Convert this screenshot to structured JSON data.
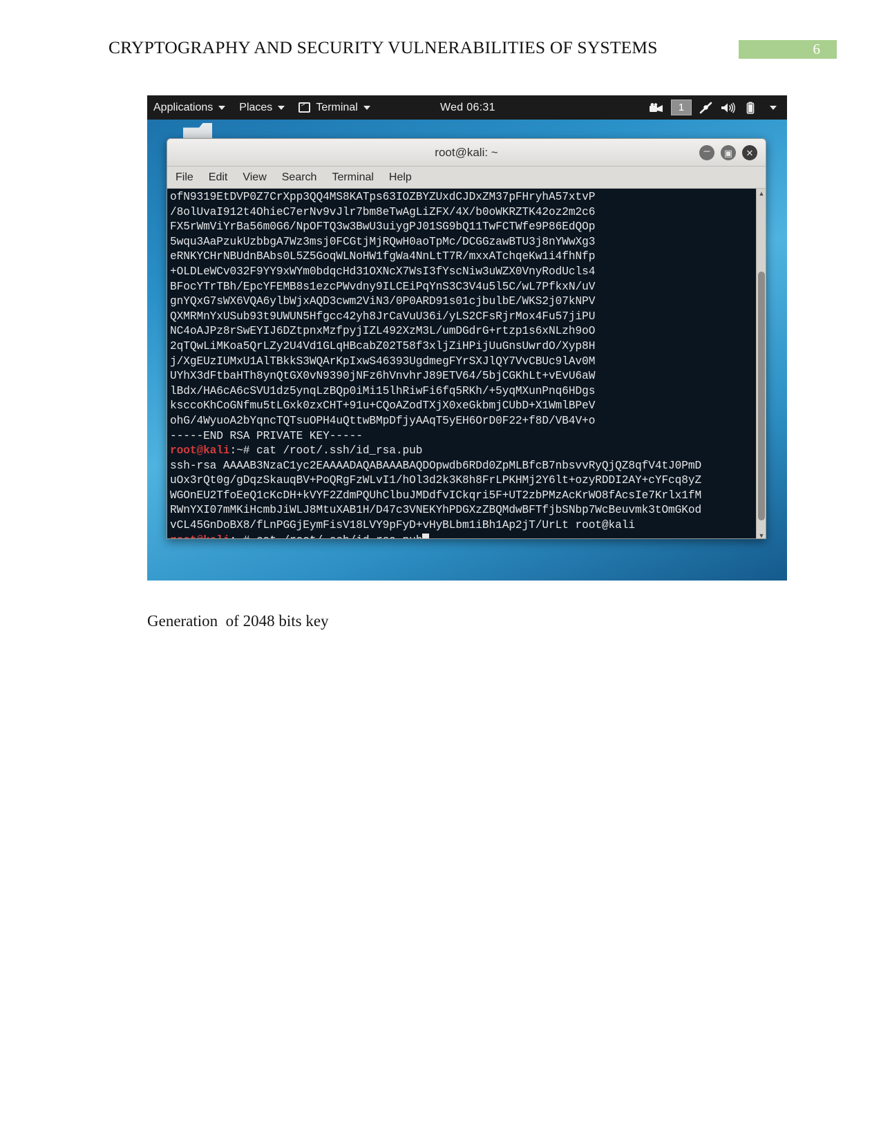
{
  "document": {
    "header_title": "CRYPTOGRAPHY AND SECURITY VULNERABILITIES OF SYSTEMS",
    "page_number": "6",
    "page_badge_color": "#a9d08e",
    "caption": "Generation  of 2048 bits key"
  },
  "desktop": {
    "panel": {
      "applications_label": "Applications",
      "places_label": "Places",
      "terminal_label": "Terminal",
      "clock": "Wed 06:31",
      "workspace_indicator": "1",
      "tray": [
        {
          "name": "screen-recorder-icon",
          "glyph": "🎥"
        },
        {
          "name": "workspace-indicator",
          "glyph": "1"
        },
        {
          "name": "bluetooth-pen-icon",
          "glyph": "✒"
        },
        {
          "name": "volume-icon",
          "glyph": "🔊"
        },
        {
          "name": "battery-icon",
          "glyph": "❙"
        },
        {
          "name": "system-menu-caret",
          "glyph": "▾"
        }
      ]
    }
  },
  "terminal_window": {
    "title": "root@kali: ~",
    "menu": [
      "File",
      "Edit",
      "View",
      "Search",
      "Terminal",
      "Help"
    ],
    "window_buttons": {
      "minimize": "–",
      "maximize": "▣",
      "close": "✕"
    },
    "lines": [
      {
        "type": "out",
        "text": "ofN9319EtDVP0Z7CrXpp3QQ4MS8KATps63IOZBYZUxdCJDxZM37pFHryhA57xtvP"
      },
      {
        "type": "out",
        "text": "/8olUvaI912t4OhieC7erNv9vJlr7bm8eTwAgLiZFX/4X/b0oWKRZTK42oz2m2c6"
      },
      {
        "type": "out",
        "text": "FX5rWmViYrBa56m0G6/NpOFTQ3w3BwU3uiygPJ01SG9bQ11TwFCTWfe9P86EdQOp"
      },
      {
        "type": "out",
        "text": "5wqu3AaPzukUzbbgA7Wz3msj0FCGtjMjRQwH0aoTpMc/DCGGzawBTU3j8nYWwXg3"
      },
      {
        "type": "out",
        "text": "eRNKYCHrNBUdnBAbs0L5Z5GoqWLNoHW1fgWa4NnLtT7R/mxxATchqeKw1i4fhNfp"
      },
      {
        "type": "out",
        "text": "+OLDLeWCv032F9YY9xWYm0bdqcHd31OXNcX7WsI3fYscNiw3uWZX0VnyRodUcls4"
      },
      {
        "type": "out",
        "text": "BFocYTrTBh/EpcYFEMB8s1ezcPWvdny9ILCEiPqYnS3C3V4u5l5C/wL7PfkxN/uV"
      },
      {
        "type": "out",
        "text": "gnYQxG7sWX6VQA6ylbWjxAQD3cwm2ViN3/0P0ARD91s01cjbulbE/WKS2j07kNPV"
      },
      {
        "type": "out",
        "text": "QXMRMnYxUSub93t9UWUN5Hfgcc42yh8JrCaVuU36i/yLS2CFsRjrMox4Fu57jiPU"
      },
      {
        "type": "out",
        "text": "NC4oAJPz8rSwEYIJ6DZtpnxMzfpyjIZL492XzM3L/umDGdrG+rtzp1s6xNLzh9oO"
      },
      {
        "type": "out",
        "text": "2qTQwLiMKoa5QrLZy2U4Vd1GLqHBcabZ02T58f3xljZiHPijUuGnsUwrdO/Xyp8H"
      },
      {
        "type": "out",
        "text": "j/XgEUzIUMxU1AlTBkkS3WQArKpIxwS46393UgdmegFYrSXJlQY7VvCBUc9lAv0M"
      },
      {
        "type": "out",
        "text": "UYhX3dFtbaHTh8ynQtGX0vN9390jNFz6hVnvhrJ89ETV64/5bjCGKhLt+vEvU6aW"
      },
      {
        "type": "out",
        "text": "lBdx/HA6cA6cSVU1dz5ynqLzBQp0iMi15lhRiwFi6fq5RKh/+5yqMXunPnq6HDgs"
      },
      {
        "type": "out",
        "text": "ksccoKhCoGNfmu5tLGxk0zxCHT+91u+CQoAZodTXjX0xeGkbmjCUbD+X1WmlBPeV"
      },
      {
        "type": "out",
        "text": "ohG/4WyuoA2bYqncTQTsuOPH4uQttwBMpDfjyAAqT5yEH6OrD0F22+f8D/VB4V+o"
      },
      {
        "type": "out",
        "text": "-----END RSA PRIVATE KEY-----"
      },
      {
        "type": "prompt",
        "user": "root@kali",
        "path": ":~# ",
        "cmd": "cat /root/.ssh/id_rsa.pub"
      },
      {
        "type": "out",
        "text": "ssh-rsa AAAAB3NzaC1yc2EAAAADAQABAAABAQDOpwdb6RDd0ZpMLBfcB7nbsvvRyQjQZ8qfV4tJ0PmD"
      },
      {
        "type": "out",
        "text": "uOx3rQt0g/gDqzSkauqBV+PoQRgFzWLvI1/hOl3d2k3K8h8FrLPKHMj2Y6lt+ozyRDDI2AY+cYFcq8yZ"
      },
      {
        "type": "out",
        "text": "WGOnEU2TfoEeQ1cKcDH+kVYF2ZdmPQUhClbuJMDdfvICkqri5F+UT2zbPMzAcKrWO8fAcsIe7Krlx1fM"
      },
      {
        "type": "out",
        "text": "RWnYXI07mMKiHcmbJiWLJ8MtuXAB1H/D47c3VNEKYhPDGXzZBQMdwBFTfjbSNbp7WcBeuvmk3tOmGKod"
      },
      {
        "type": "out",
        "text": "vCL45GnDoBX8/fLnPGGjEymFisV18LVY9pFyD+vHyBLbm1iBh1Ap2jT/UrLt root@kali"
      },
      {
        "type": "prompt-cursor",
        "user": "root@kali",
        "path": ":~# ",
        "cmd": "cat /root/.ssh/id_rsa.pub"
      }
    ]
  }
}
